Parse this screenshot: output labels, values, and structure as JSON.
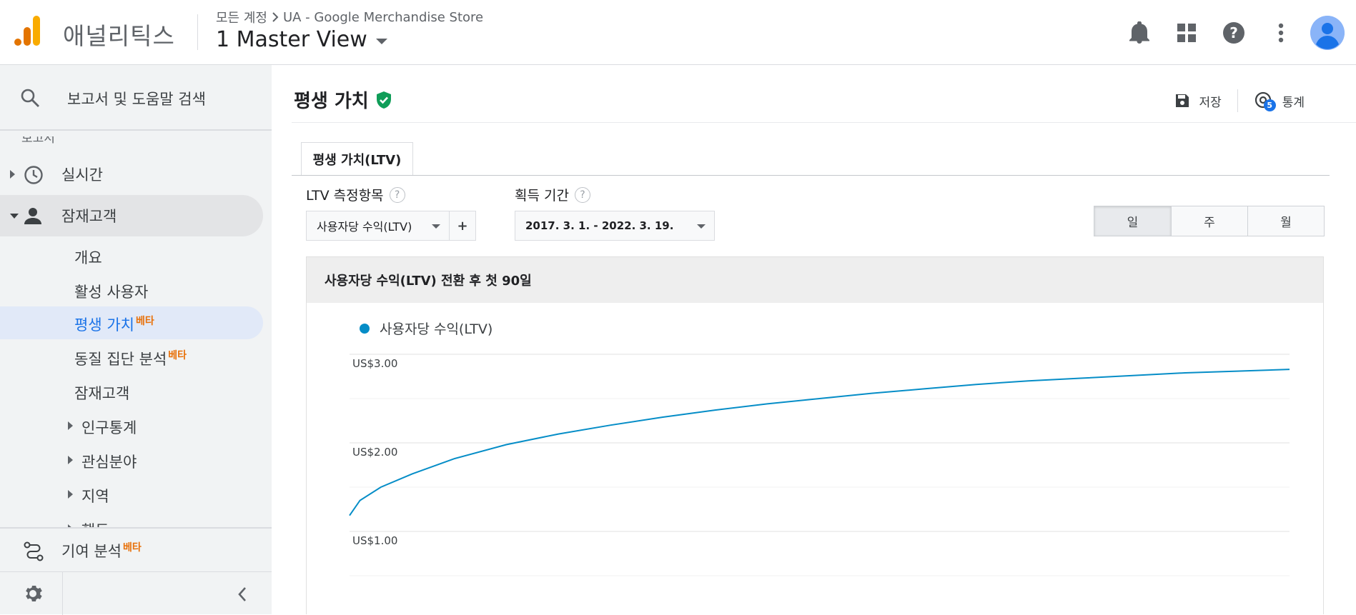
{
  "app": {
    "name": "애널리틱스",
    "breadcrumb": {
      "all_accounts": "모든 계정",
      "property": "UA - Google Merchandise Store"
    },
    "view": "1 Master View"
  },
  "sidebar": {
    "search_label": "보고서 및 도움말 검색",
    "section_label": "보고서",
    "realtime": "실시간",
    "audience": "잠재고객",
    "sub": {
      "overview": "개요",
      "active_users": "활성 사용자",
      "lifetime_value": "평생 가치",
      "cohort": "동질 집단 분석",
      "audiences": "잠재고객",
      "demographics": "인구통계",
      "interests": "관심분야",
      "geo": "지역",
      "behavior": "행동"
    },
    "attribution": "기여 분석",
    "beta": "베타"
  },
  "main": {
    "title": "평생 가치",
    "save": "저장",
    "insights": "통계",
    "insights_badge": "5",
    "tab": "평생 가치(LTV)",
    "ltv_metric_label": "LTV 측정항목",
    "ltv_metric_value": "사용자당 수익(LTV)",
    "plus": "+",
    "acq_label": "획득 기간",
    "acq_value": "2017. 3. 1. - 2022. 3. 19.",
    "qmark": "?",
    "granularity": [
      "일",
      "주",
      "월"
    ],
    "chart_title": "사용자당 수익(LTV) 전환 후 첫 90일",
    "legend": "사용자당 수익(LTV)"
  },
  "colors": {
    "series": "#058dc7",
    "accent": "#1a73e8",
    "beta": "#e8710a",
    "verified": "#0f9d58"
  },
  "chart_data": {
    "type": "line",
    "ylabel_ticks": [
      "US$3.00",
      "US$2.00",
      "US$1.00"
    ],
    "y_ticks": [
      3,
      2,
      1
    ],
    "ylim": [
      0.5,
      3.1
    ],
    "series": [
      {
        "name": "사용자당 수익(LTV)",
        "x": [
          0,
          1,
          3,
          6,
          10,
          15,
          20,
          25,
          30,
          35,
          40,
          45,
          50,
          55,
          60,
          65,
          70,
          75,
          80,
          85,
          90
        ],
        "values": [
          1.18,
          1.35,
          1.5,
          1.65,
          1.82,
          1.98,
          2.1,
          2.2,
          2.29,
          2.37,
          2.44,
          2.5,
          2.56,
          2.61,
          2.66,
          2.7,
          2.73,
          2.76,
          2.79,
          2.81,
          2.83
        ]
      }
    ]
  }
}
